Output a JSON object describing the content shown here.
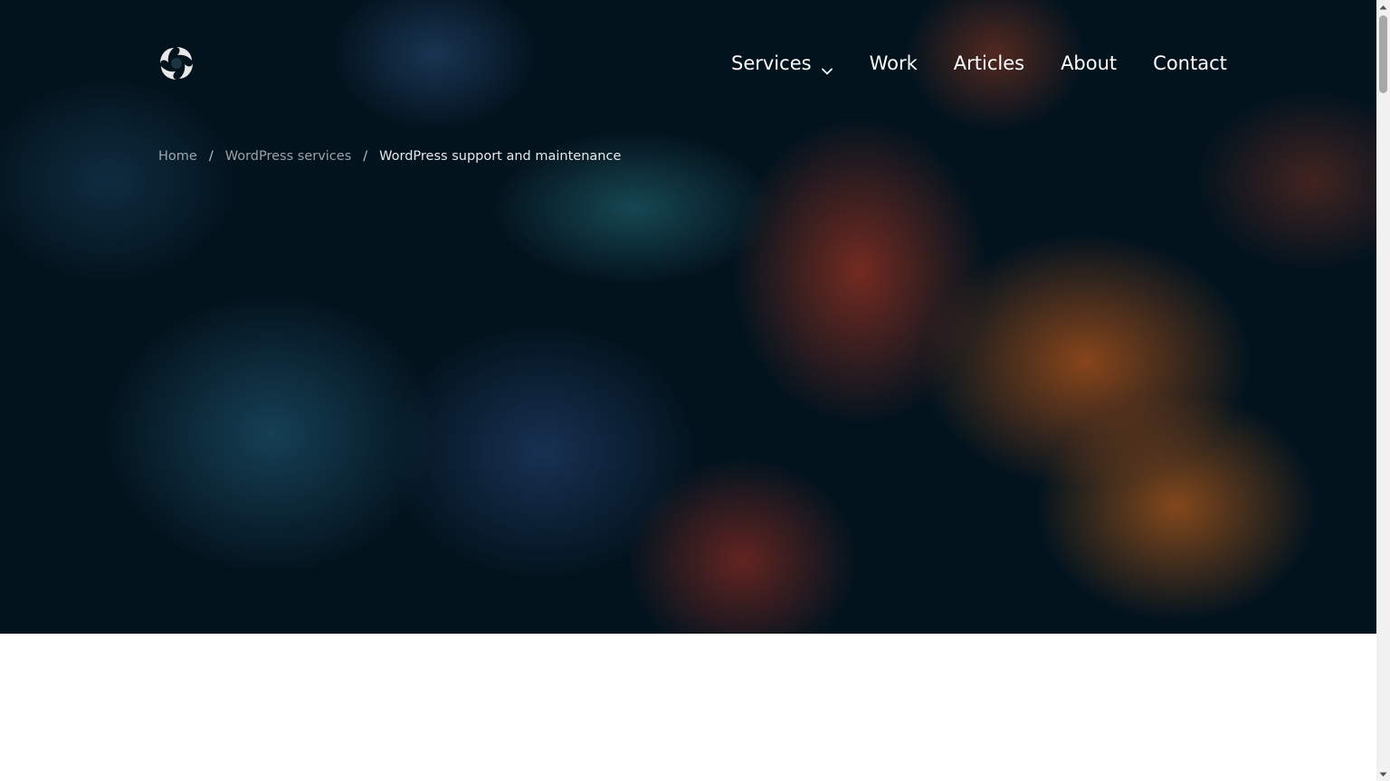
{
  "header": {
    "logo": {
      "icon": "swirl-logo-icon"
    },
    "nav": {
      "items": [
        {
          "label": "Services",
          "has_dropdown": true
        },
        {
          "label": "Work"
        },
        {
          "label": "Articles"
        },
        {
          "label": "About"
        },
        {
          "label": "Contact"
        }
      ]
    }
  },
  "breadcrumb": {
    "items": [
      {
        "label": "Home"
      },
      {
        "label": "WordPress services"
      }
    ],
    "separator": "/",
    "current": "WordPress support and maintenance"
  },
  "colors": {
    "nav_text": "#ffffff",
    "hero_dark": "#061a24",
    "accent_orange": "#e66e1e",
    "accent_teal": "#28788a"
  }
}
